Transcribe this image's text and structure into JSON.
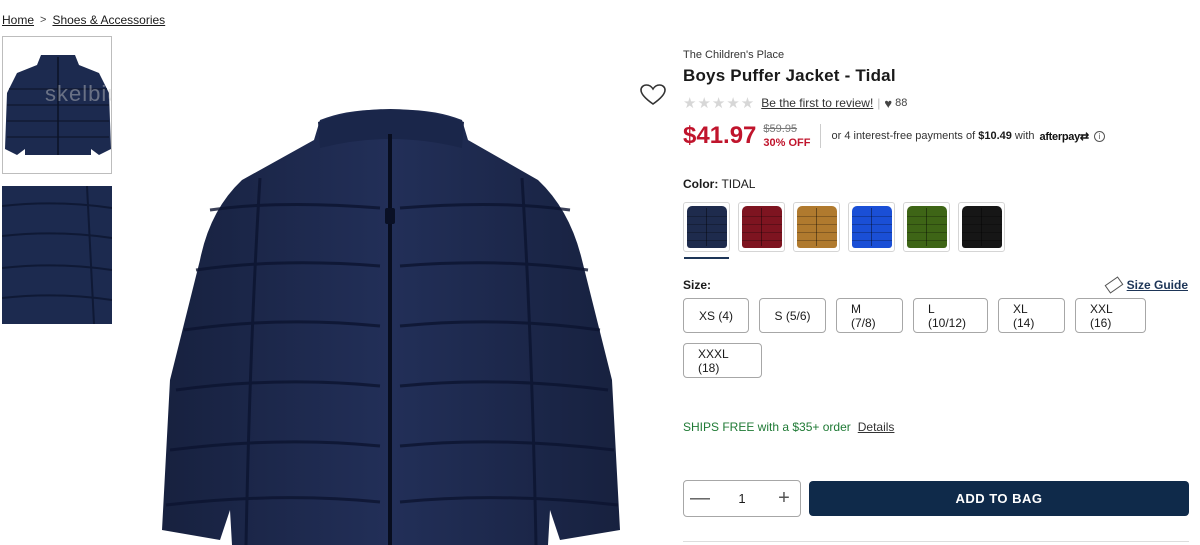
{
  "breadcrumb": {
    "home": "Home",
    "separator": ">",
    "category": "Shoes & Accessories"
  },
  "thumbnails": {
    "watermark": "skelbiu.lt"
  },
  "product": {
    "brand": "The Children's Place",
    "title": "Boys Puffer Jacket - Tidal",
    "review_link": "Be the first to review!",
    "favorites_count": "88",
    "price": "$41.97",
    "old_price": "$59.95",
    "discount": "30% OFF",
    "installments_prefix": "or 4 interest-free payments of ",
    "installment_amount": "$10.49",
    "installments_suffix": " with",
    "afterpay": "afterpay",
    "afterpay_mark": "⇄",
    "info_icon": "i"
  },
  "color": {
    "label": "Color:",
    "value": "TIDAL",
    "swatches": [
      {
        "name": "Tidal",
        "hex": "#1e2b4d",
        "selected": true
      },
      {
        "name": "Red",
        "hex": "#7e1420"
      },
      {
        "name": "Tan",
        "hex": "#b07a2e"
      },
      {
        "name": "Blue",
        "hex": "#1a4fd6"
      },
      {
        "name": "Olive",
        "hex": "#3e6516"
      },
      {
        "name": "Black",
        "hex": "#161616"
      }
    ]
  },
  "size": {
    "label": "Size:",
    "guide": "Size Guide",
    "options": [
      "XS (4)",
      "S (5/6)",
      "M (7/8)",
      "L (10/12)",
      "XL (14)",
      "XXL (16)",
      "XXXL (18)"
    ]
  },
  "shipping": {
    "text": "SHIPS FREE with a $35+ order",
    "details": "Details"
  },
  "cart": {
    "quantity": "1",
    "minus": "—",
    "plus": "+",
    "add_label": "ADD TO BAG"
  },
  "colors": {
    "price_red": "#c0142c",
    "navy": "#0f2a4a",
    "jacket": "#1c2a4f"
  }
}
